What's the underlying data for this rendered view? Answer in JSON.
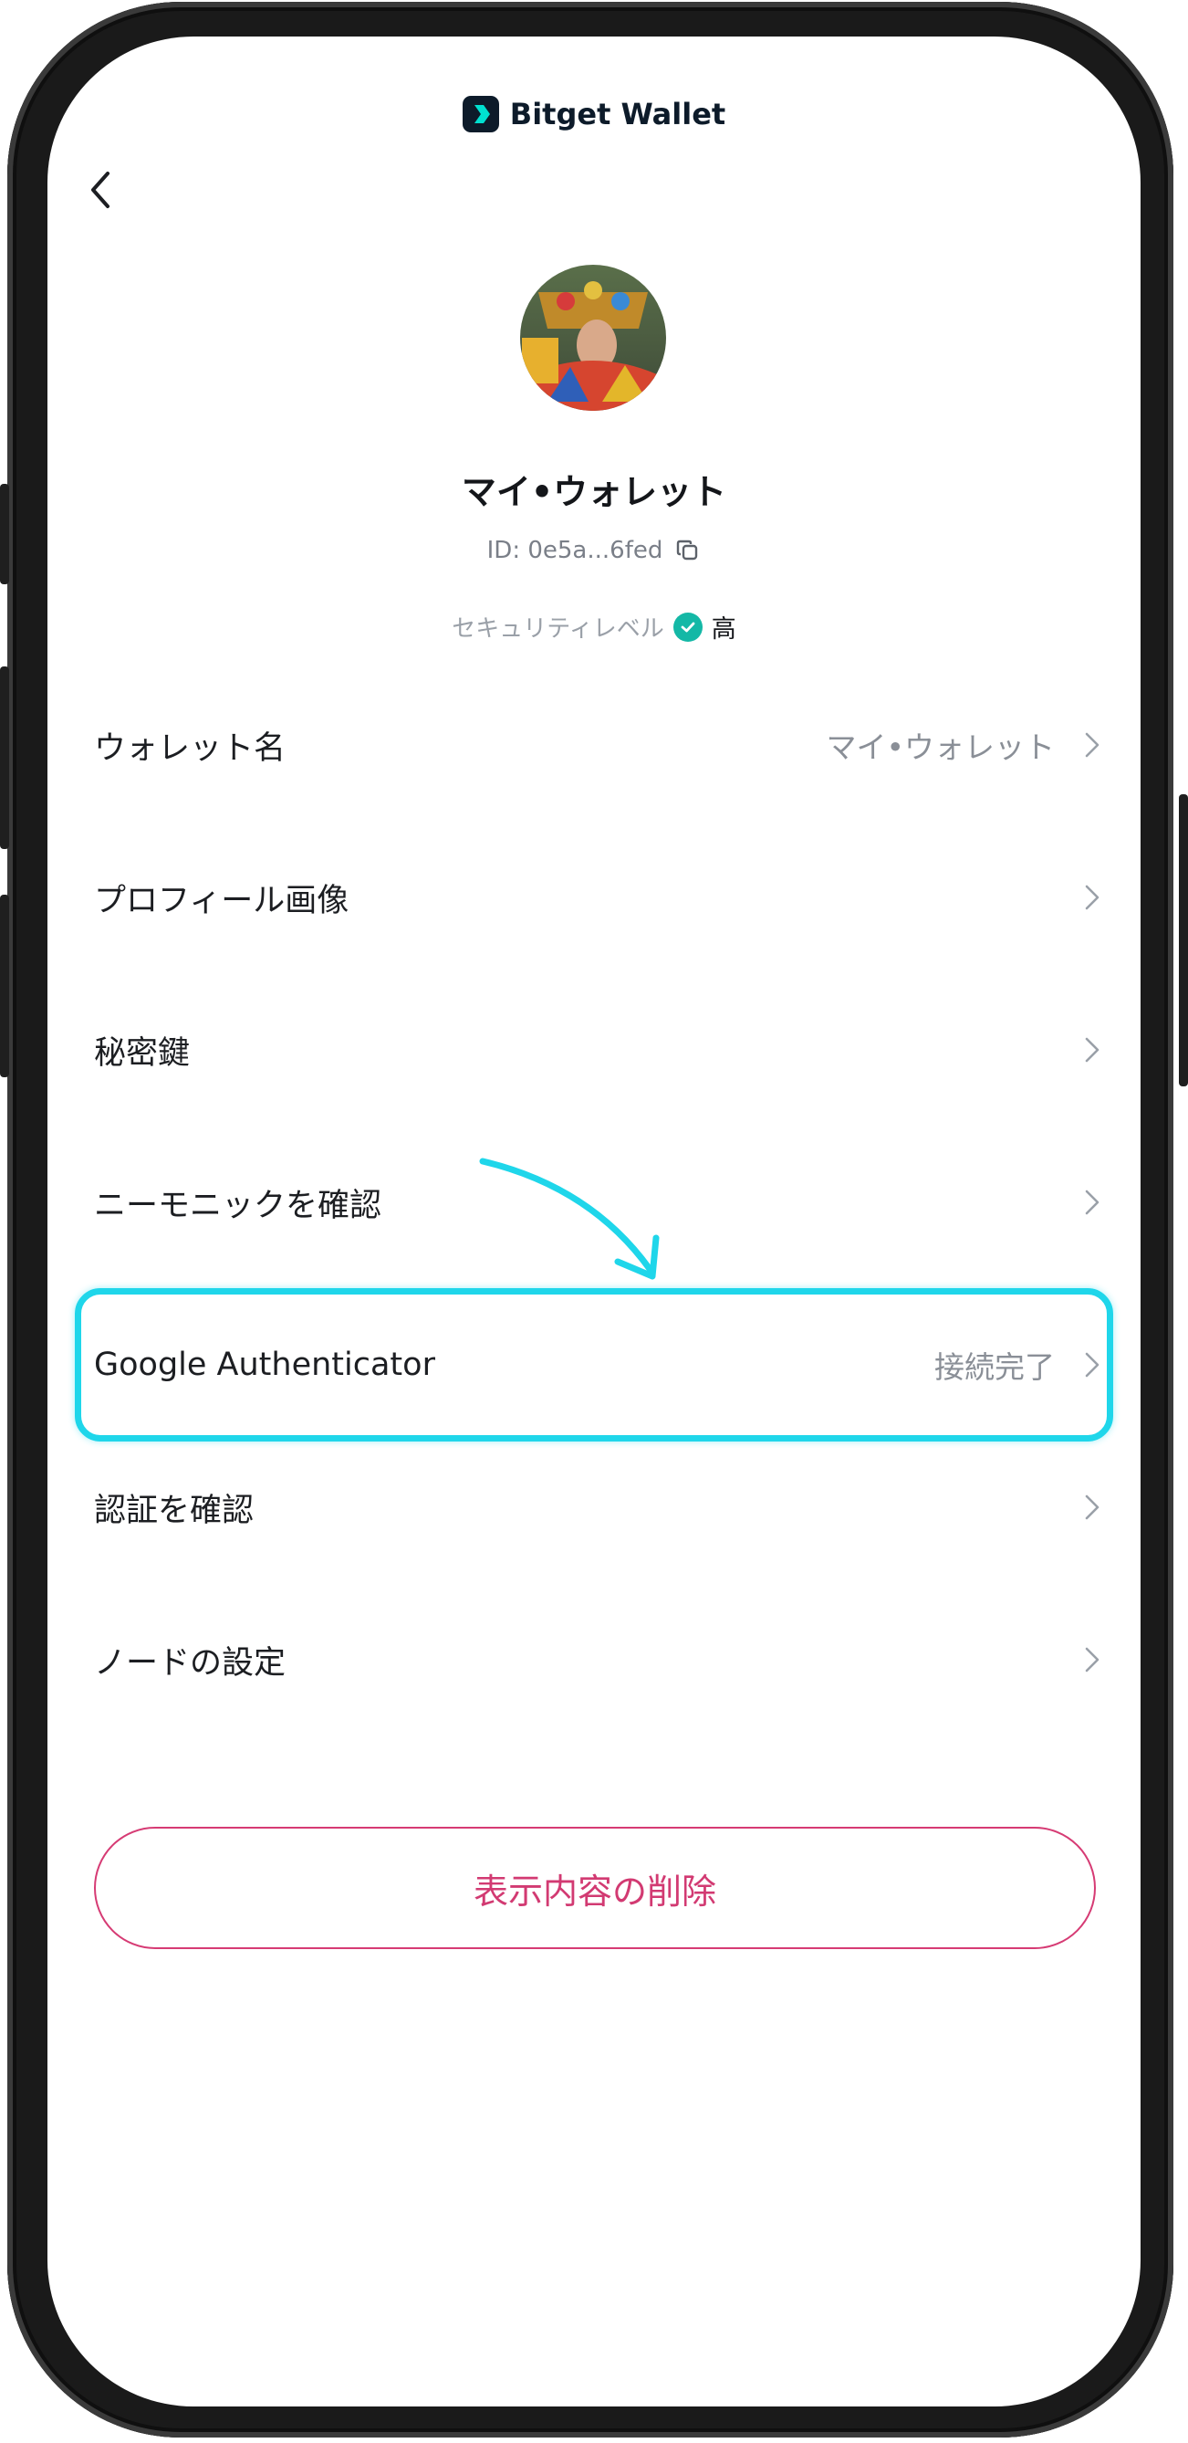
{
  "app": {
    "logo_text": "Bitget Wallet"
  },
  "header": {
    "back_icon": "chevron-left-icon"
  },
  "profile": {
    "wallet_name": "マイ•ウォレット",
    "id_text": "ID: 0e5a...6fed",
    "security_label": "セキュリティレベル",
    "security_level": "高"
  },
  "settings": [
    {
      "label": "ウォレット名",
      "value": "マイ•ウォレット"
    },
    {
      "label": "プロフィール画像",
      "value": ""
    },
    {
      "label": "秘密鍵",
      "value": ""
    },
    {
      "label": "ニーモニックを確認",
      "value": ""
    },
    {
      "label": "Google Authenticator",
      "value": "接続完了"
    },
    {
      "label": "認証を確認",
      "value": ""
    },
    {
      "label": "ノードの設定",
      "value": ""
    }
  ],
  "delete_button": {
    "label": "表示内容の削除"
  },
  "colors": {
    "accent_highlight": "#1fd6ea",
    "danger": "#d23a72",
    "security_check": "#14b8a6"
  }
}
